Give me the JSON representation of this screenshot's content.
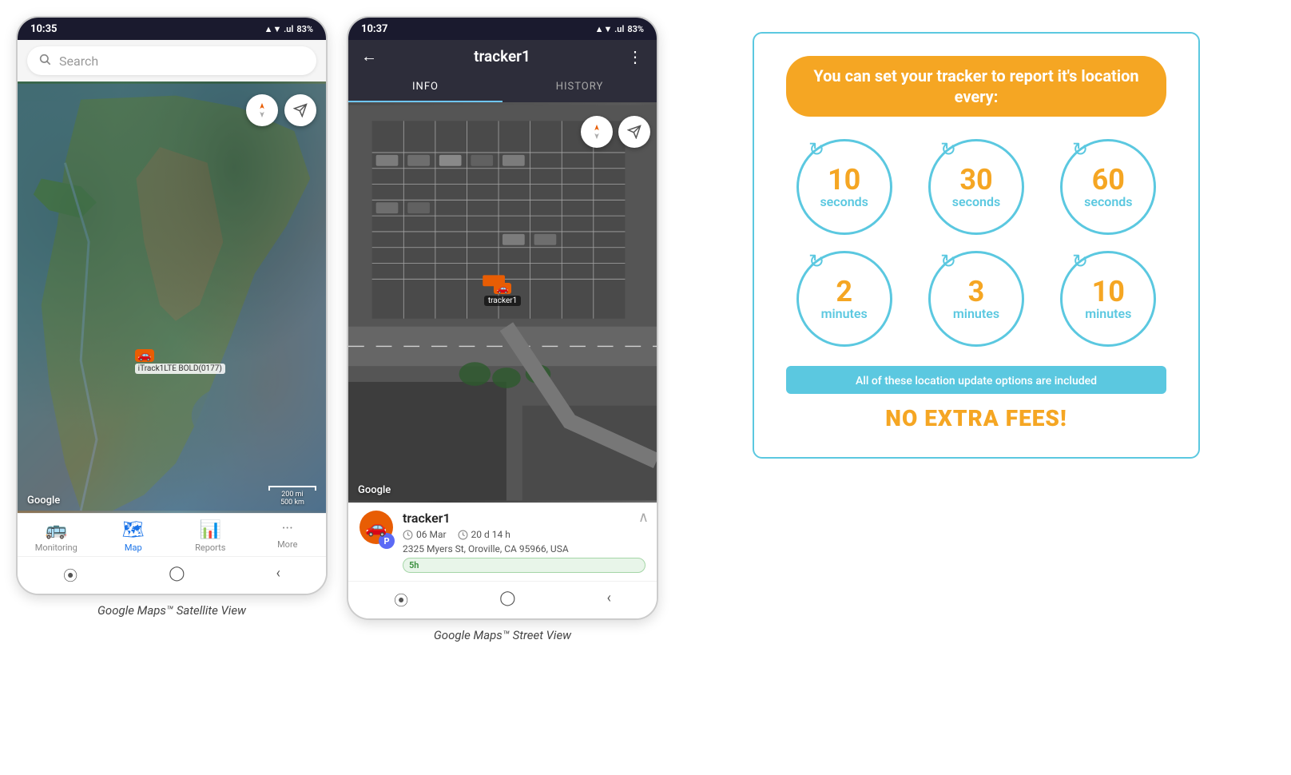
{
  "phone1": {
    "status_bar": {
      "time": "10:35",
      "signal": "▲▼ .ul",
      "battery": "83%"
    },
    "search_placeholder": "Search",
    "tracker_label": "iTrack1LTE BOLD(0177)",
    "google_label": "Google",
    "scale_200mi": "200 mi",
    "scale_500km": "500 km",
    "nav": {
      "items": [
        {
          "label": "Monitoring",
          "icon": "🚌"
        },
        {
          "label": "Map",
          "icon": "🗺",
          "active": true
        },
        {
          "label": "Reports",
          "icon": "📊"
        },
        {
          "label": "More",
          "icon": "···"
        }
      ]
    }
  },
  "phone2": {
    "status_bar": {
      "time": "10:37",
      "battery": "83%"
    },
    "header": {
      "title": "tracker1",
      "back_icon": "←",
      "menu_icon": "⋮"
    },
    "tabs": [
      {
        "label": "INFO",
        "active": true
      },
      {
        "label": "HISTORY",
        "active": false
      }
    ],
    "tracker_info": {
      "name": "tracker1",
      "date": "06 Mar",
      "duration": "20 d 14 h",
      "address": "2325 Myers St, Oroville, CA 95966, USA",
      "time_badge": "5h"
    },
    "tracker_car_label": "tracker1",
    "google_label": "Google"
  },
  "right_panel": {
    "promo_title": "You can set your tracker to report it's location every:",
    "intervals": [
      {
        "number": "10",
        "unit": "seconds"
      },
      {
        "number": "30",
        "unit": "seconds"
      },
      {
        "number": "60",
        "unit": "seconds"
      },
      {
        "number": "2",
        "unit": "minutes"
      },
      {
        "number": "3",
        "unit": "minutes"
      },
      {
        "number": "10",
        "unit": "minutes"
      }
    ],
    "no_fees_text": "All of these location update options are included",
    "no_extra_fees": "NO EXTRA FEES!"
  },
  "captions": {
    "phone1": "Google Maps™ Satellite View",
    "phone2": "Google Maps™ Street View"
  }
}
